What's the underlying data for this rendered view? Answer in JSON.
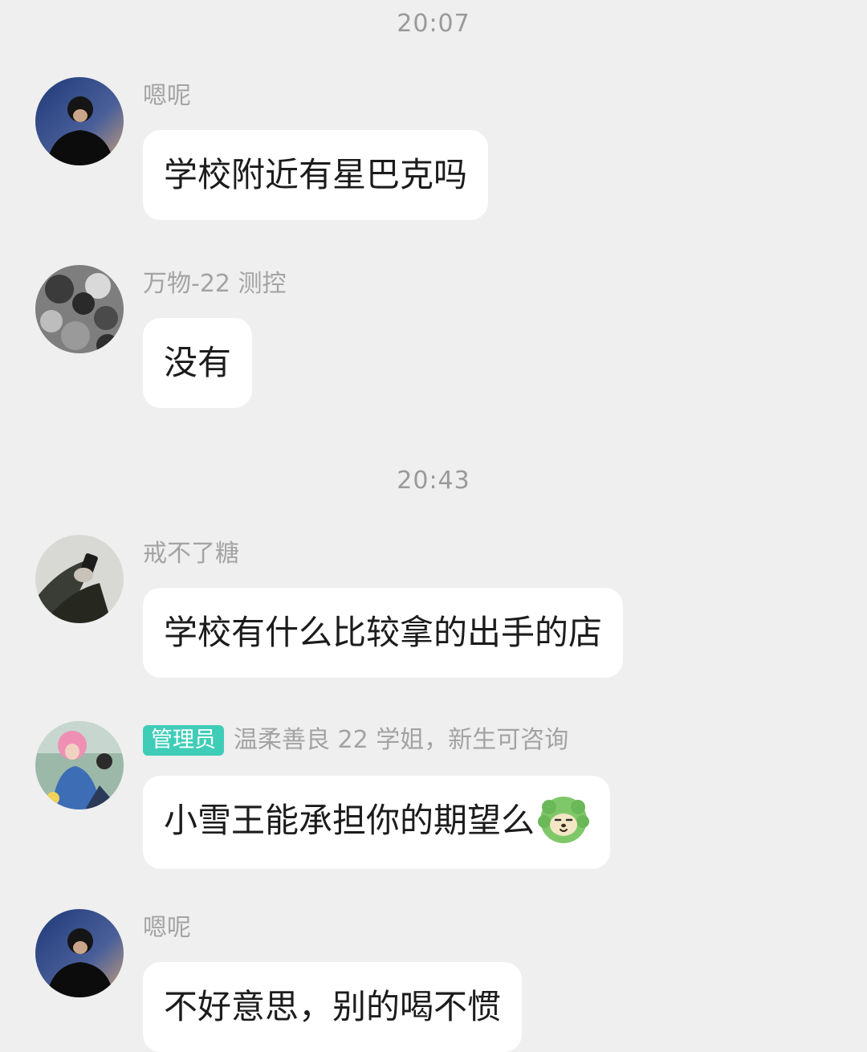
{
  "timestamps": [
    "20:07",
    "20:43"
  ],
  "messages": [
    {
      "sender": "嗯呢",
      "text": "学校附近有星巴克吗",
      "avatar_icon": "avatar-man-dark-icon"
    },
    {
      "sender": "万物-22 测控",
      "text": "没有",
      "avatar_icon": "avatar-group-photo-icon"
    },
    {
      "sender": "戒不了糖",
      "text": "学校有什么比较拿的出手的店",
      "avatar_icon": "avatar-hand-phone-icon"
    },
    {
      "badge": "管理员",
      "sender": "温柔善良 22 学姐，新生可咨询",
      "text": "小雪王能承担你的期望么",
      "emoji": "green-dog-sticker-icon",
      "avatar_icon": "avatar-pink-hair-icon"
    },
    {
      "sender": "嗯呢",
      "text": "不好意思，别的喝不惯",
      "avatar_icon": "avatar-man-dark-icon"
    }
  ],
  "colors": {
    "background": "#efefef",
    "bubble": "#ffffff",
    "badge": "#3fcdb8",
    "name": "#a3a3a3",
    "timestamp": "#9a9a9a"
  }
}
